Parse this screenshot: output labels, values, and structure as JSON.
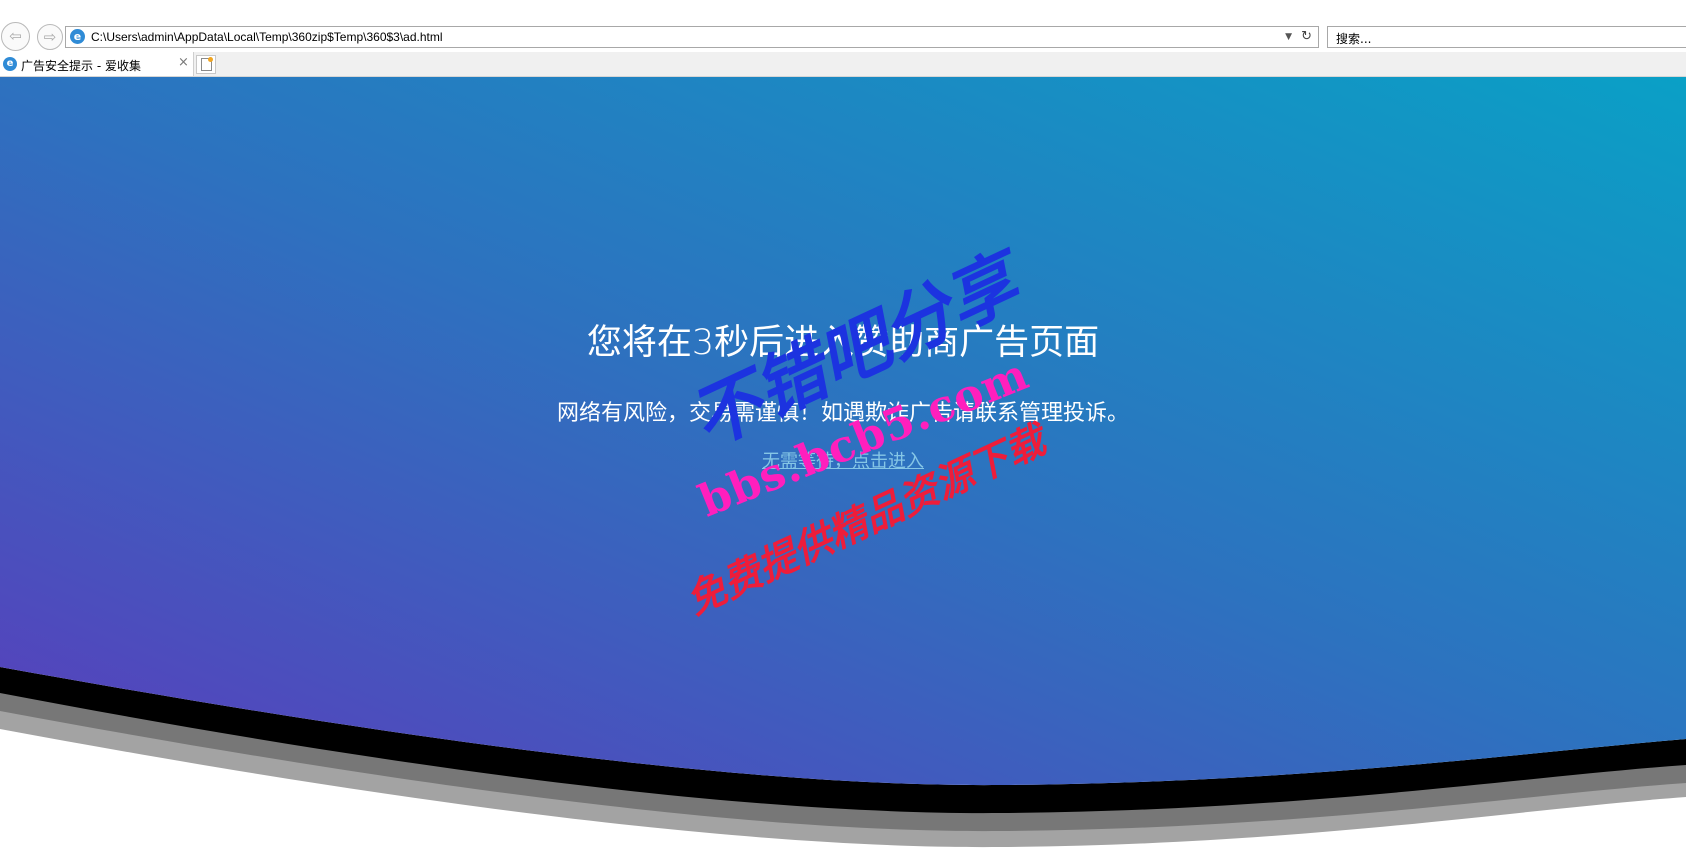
{
  "browser": {
    "address": "C:\\Users\\admin\\AppData\\Local\\Temp\\360zip$Temp\\360$3\\ad.html",
    "search_placeholder": "搜索...",
    "tab_title": "广告安全提示 - 爱收集",
    "tab_close": "×"
  },
  "page": {
    "heading": "您将在3秒后进入赞助商广告页面",
    "notice": "网络有风险，交易需谨慎！如遇欺诈广告请联系管理投诉。",
    "enter_link": "无需等待，点击进入"
  },
  "watermark": {
    "line1": "不错吧分享",
    "line2": "bbs.bcb5.com",
    "line3": "免费提供精品资源下载"
  },
  "colors": {
    "gradient_start": "#5a3dbc",
    "gradient_end": "#0aa0c6",
    "link": "#85c6e6"
  }
}
